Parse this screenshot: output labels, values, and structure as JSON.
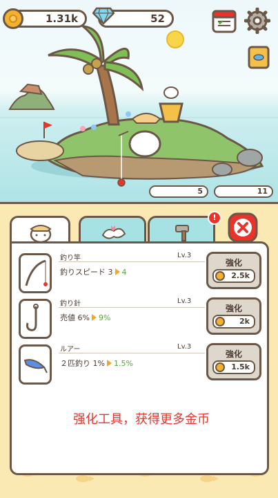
{
  "hud": {
    "coins": "1.31k",
    "gems": "52",
    "coin_icon": "coin-icon",
    "gem_icon": "diamond-icon",
    "buttons": [
      "calendar-icon",
      "gear-icon",
      "fish-book-icon"
    ]
  },
  "scene": {
    "catch_count": "5",
    "time_count": "11"
  },
  "tabs": [
    {
      "name": "cat-head-icon",
      "active": true
    },
    {
      "name": "decoration-icon",
      "active": false
    },
    {
      "name": "hammer-icon",
      "active": false,
      "badge": "!"
    }
  ],
  "upgrades": [
    {
      "name": "釣り竿",
      "level": "Lv.3",
      "stat": "釣りスピード 3",
      "next": "4",
      "button": "強化",
      "price": "2.5k",
      "icon": "fishing-rod-icon"
    },
    {
      "name": "釣り針",
      "level": "Lv.3",
      "stat": "売値 6%",
      "next": "9%",
      "button": "強化",
      "price": "2k",
      "icon": "fish-hook-icon"
    },
    {
      "name": "ルアー",
      "level": "Lv.3",
      "stat": "２匹釣り 1%",
      "next": "1.5%",
      "button": "強化",
      "price": "1.5k",
      "icon": "lure-icon"
    }
  ],
  "promo": "强化工具，获得更多金币",
  "colors": {
    "accent": "#e8342a",
    "outline": "#6b5747",
    "panel": "#fbe9b4",
    "green": "#52a83d"
  }
}
